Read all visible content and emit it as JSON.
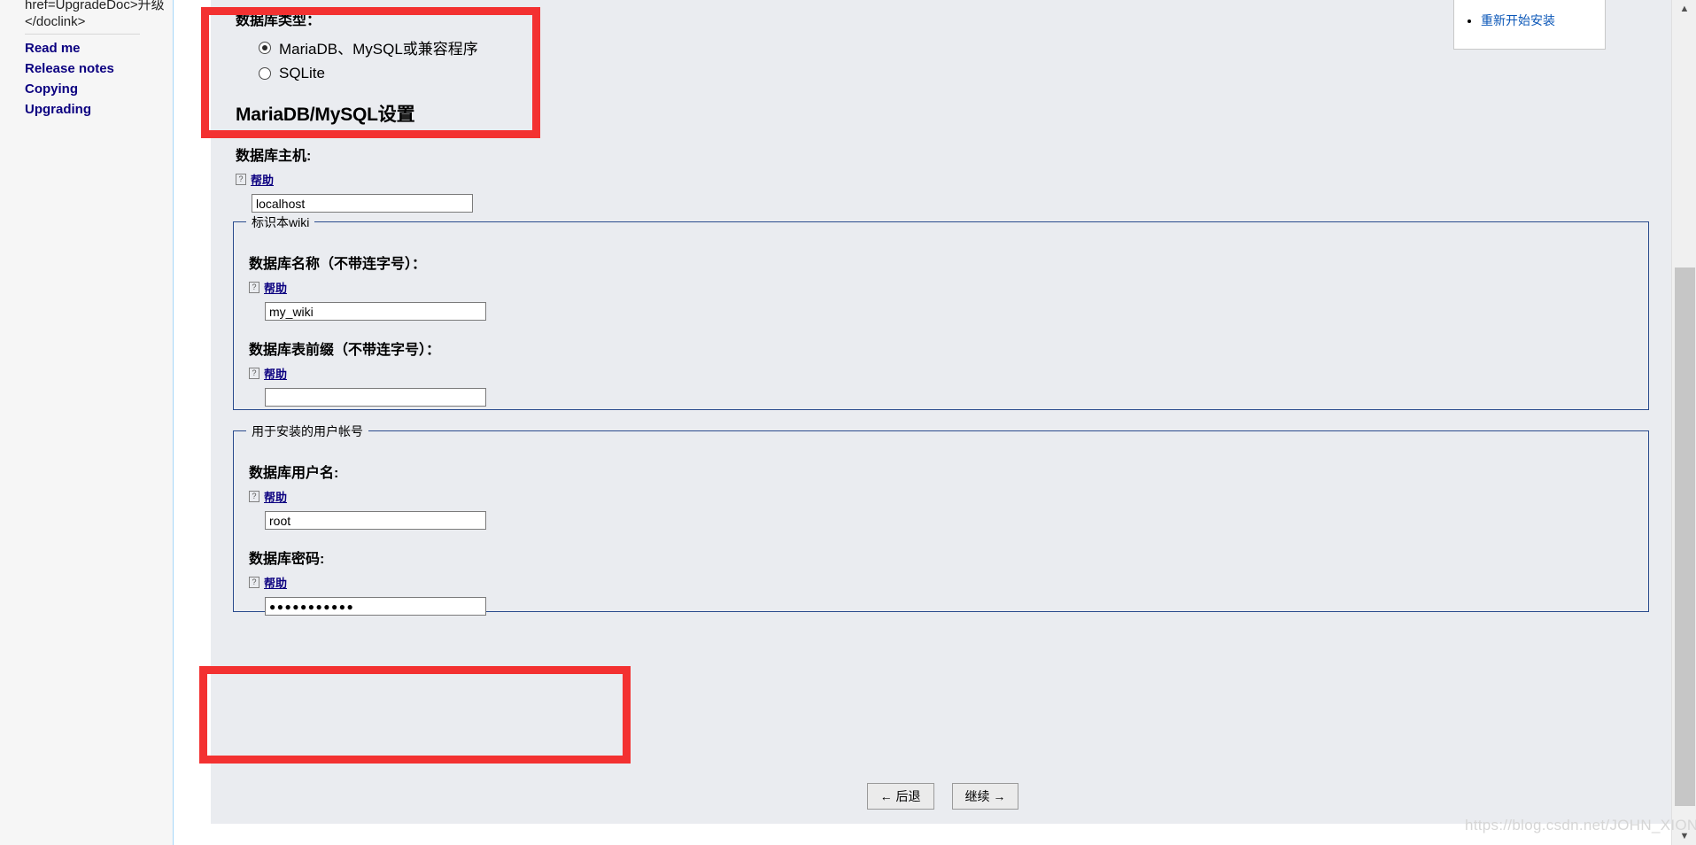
{
  "sidebar": {
    "code_snippet": "href=UpgradeDoc>升级</doclink>",
    "links": [
      {
        "label": "Read me"
      },
      {
        "label": "Release notes"
      },
      {
        "label": "Copying"
      },
      {
        "label": "Upgrading"
      }
    ]
  },
  "info_box": {
    "restart_link": "重新开始安装"
  },
  "form": {
    "db_type": {
      "label": "数据库类型：",
      "options": [
        {
          "label": "MariaDB、MySQL或兼容程序",
          "selected": true
        },
        {
          "label": "SQLite",
          "selected": false
        }
      ]
    },
    "mysql_heading": "MariaDB/MySQL设置",
    "host": {
      "label": "数据库主机:",
      "help": "帮助",
      "help_icon": "question-box-icon",
      "value": "localhost",
      "placeholder": ""
    },
    "wiki_fieldset": {
      "legend": "标识本wiki",
      "db_name": {
        "label": "数据库名称（不带连字号）：",
        "help": "帮助",
        "value": "my_wiki",
        "placeholder": ""
      },
      "db_prefix": {
        "label": "数据库表前缀（不带连字号）：",
        "help": "帮助",
        "value": "",
        "placeholder": ""
      }
    },
    "account_fieldset": {
      "legend": "用于安装的用户帐号",
      "db_user": {
        "label": "数据库用户名:",
        "help": "帮助",
        "value": "root",
        "placeholder": ""
      },
      "db_password": {
        "label": "数据库密码:",
        "help": "帮助",
        "value": "●●●●●●●●●●●",
        "placeholder": ""
      }
    },
    "buttons": {
      "back": "← 后退",
      "continue": "继续 →"
    }
  },
  "scrollbar": {
    "up_arrow": "chevron-up-icon",
    "down_arrow": "chevron-down-icon"
  },
  "watermark": "https://blog.csdn.net/JOHN_XIONG",
  "colors": {
    "link": "#0b0080",
    "fieldset_border": "#2a4b8d",
    "panel_bg": "#eaecf0",
    "annotation_red": "#f33131",
    "sidebar_bg": "#f6f6f6"
  }
}
